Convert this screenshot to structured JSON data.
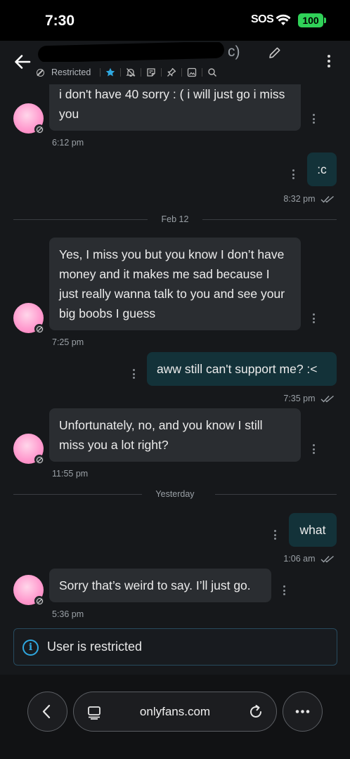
{
  "status": {
    "time": "7:30",
    "sos": "SOS",
    "battery": "100"
  },
  "header": {
    "name_suffix": "c)",
    "restricted_label": "Restricted"
  },
  "messages": [
    {
      "dir": "in",
      "text": "i don't have 40 sorry : ( i will just go i miss you",
      "time": "6:12 pm"
    },
    {
      "dir": "out",
      "text": ":c",
      "time": "8:32 pm"
    },
    {
      "dir": "in",
      "text": "Yes, I miss you but you know I don’t have money and it makes me sad because I just really wanna talk to you and see your big boobs I guess",
      "time": "7:25 pm"
    },
    {
      "dir": "out",
      "text": "aww still can't support me? :<",
      "time": "7:35 pm"
    },
    {
      "dir": "in",
      "text": "Unfortunately, no, and you know I still miss you a lot right?",
      "time": "11:55 pm"
    },
    {
      "dir": "out",
      "text": "what",
      "time": "1:06 am"
    },
    {
      "dir": "in",
      "text": "Sorry that’s weird to say. I’ll just go.",
      "time": "5:36 pm"
    }
  ],
  "dividers": [
    "Feb 12",
    "Yesterday"
  ],
  "notice": {
    "text": "User is restricted"
  },
  "browser": {
    "url": "onlyfans.com"
  },
  "colors": {
    "incoming_bubble": "#2a2d31",
    "outgoing_bubble": "#133239",
    "accent": "#2fa8e0",
    "battery": "#30d158"
  }
}
